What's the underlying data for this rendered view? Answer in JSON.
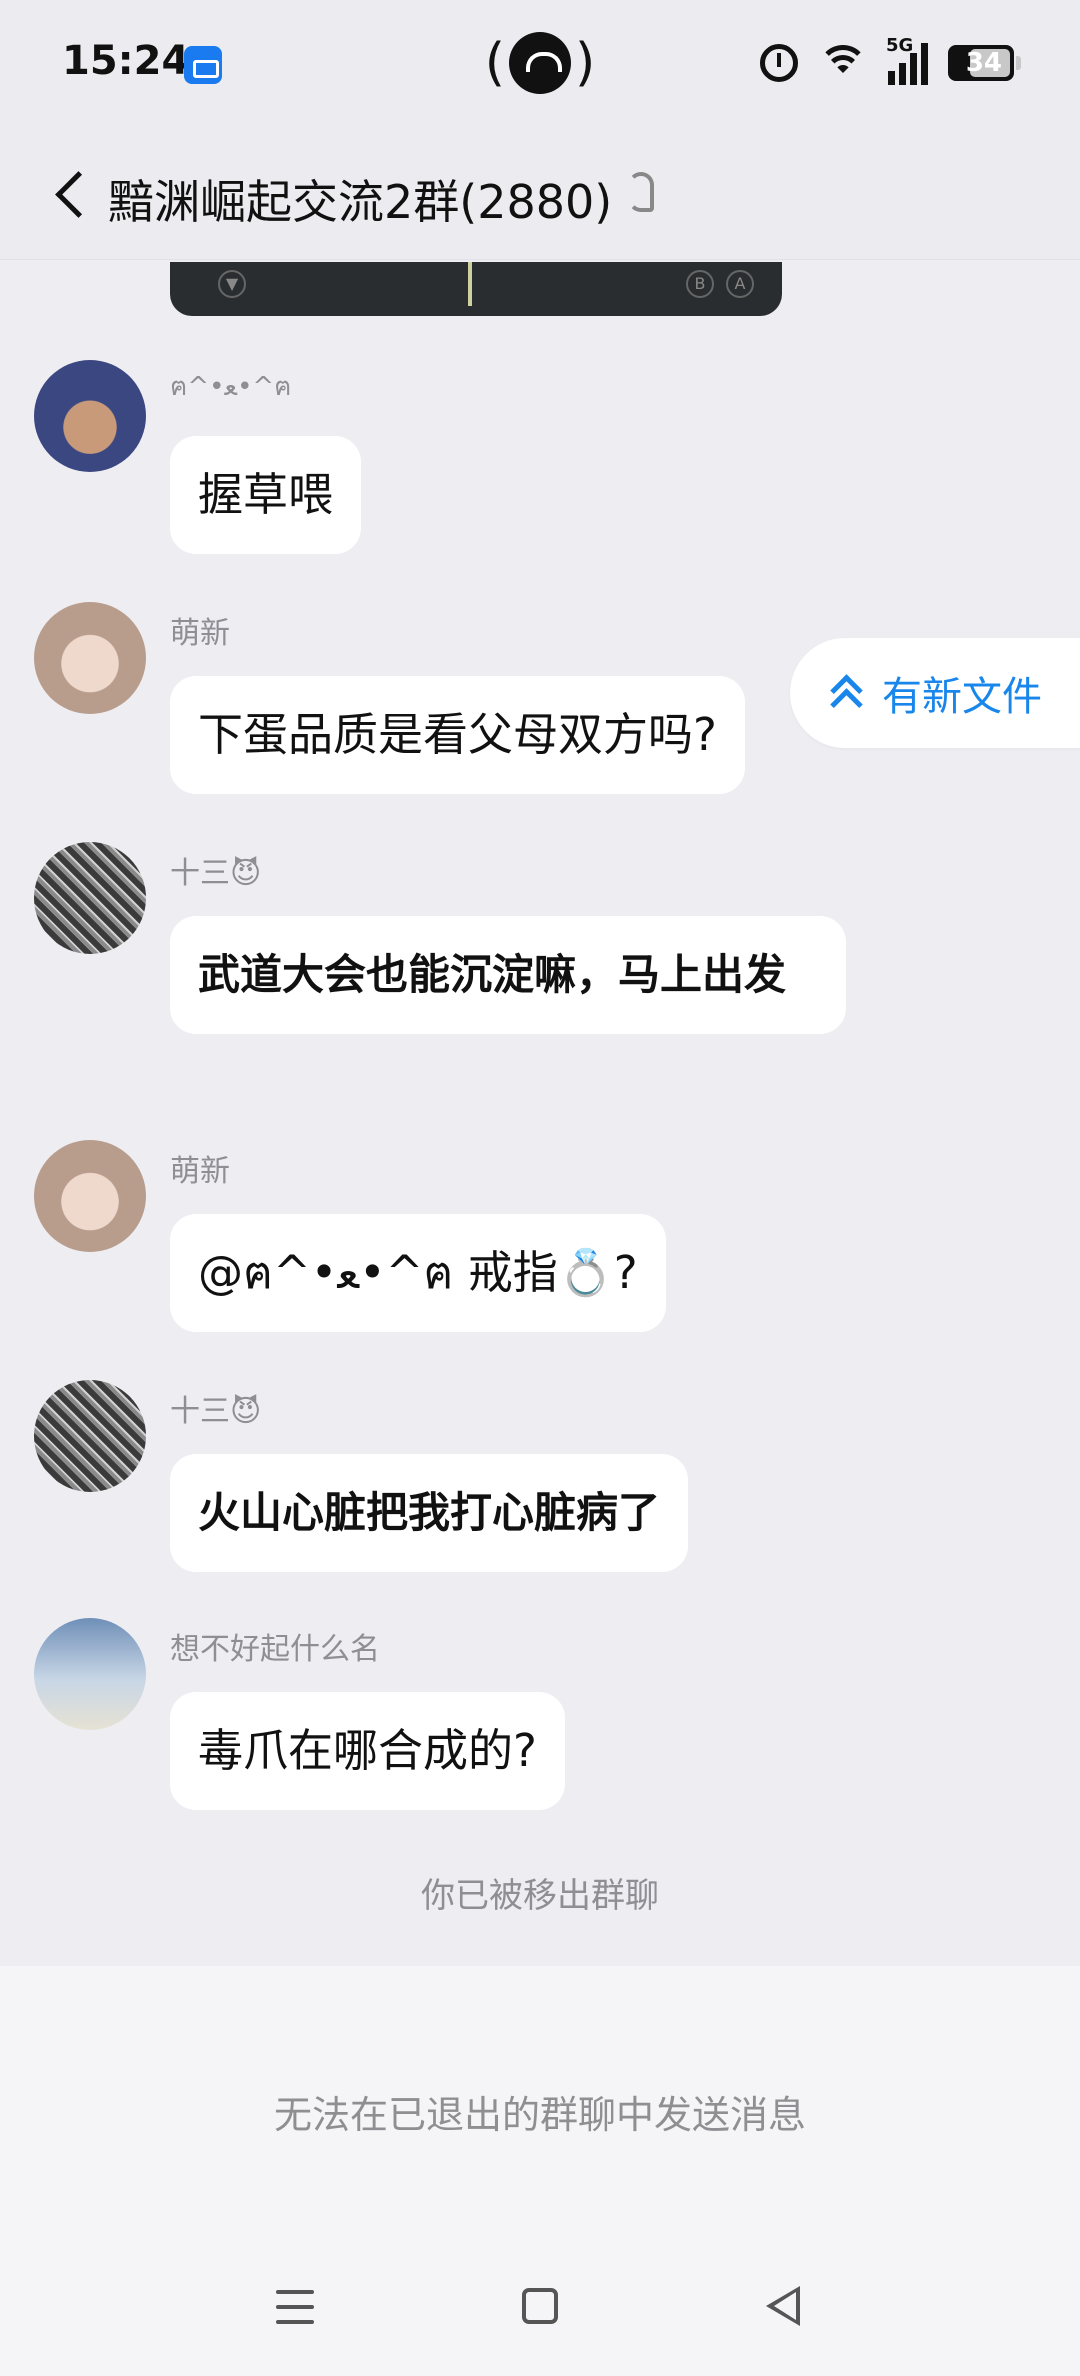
{
  "status_bar": {
    "time": "15:24",
    "network": "5G",
    "battery": "34"
  },
  "header": {
    "title": "黯渊崛起交流2群(2880)"
  },
  "messages": [
    {
      "sender": "ฅ^•ﻌ•^ฅ",
      "text": "握草喂",
      "avatar_color": "#4a5a9a"
    },
    {
      "sender": "萌新",
      "text": "下蛋品质是看父母双方吗?",
      "avatar_color": "#d8c8c0"
    },
    {
      "sender": "十三😈",
      "text": "武道大会也能沉淀嘛，马上出发",
      "avatar_color": "#5a5a5a"
    },
    {
      "sender": "萌新",
      "text": "@ฅ^•ﻌ•^ฅ 戒指💍?",
      "avatar_color": "#d8c8c0"
    },
    {
      "sender": "十三😈",
      "text": "火山心脏把我打心脏病了",
      "avatar_color": "#5a5a5a"
    },
    {
      "sender": "想不好起什么名",
      "text": "毒爪在哪合成的?",
      "avatar_color": "#8aa2bc"
    }
  ],
  "new_file_pill": {
    "label": "有新文件"
  },
  "system_note": "你已被移出群聊",
  "footer": {
    "note": "无法在已退出的群聊中发送消息"
  },
  "colors": {
    "accent": "#1886ea",
    "background": "#ededf2",
    "bubble": "#ffffff"
  }
}
